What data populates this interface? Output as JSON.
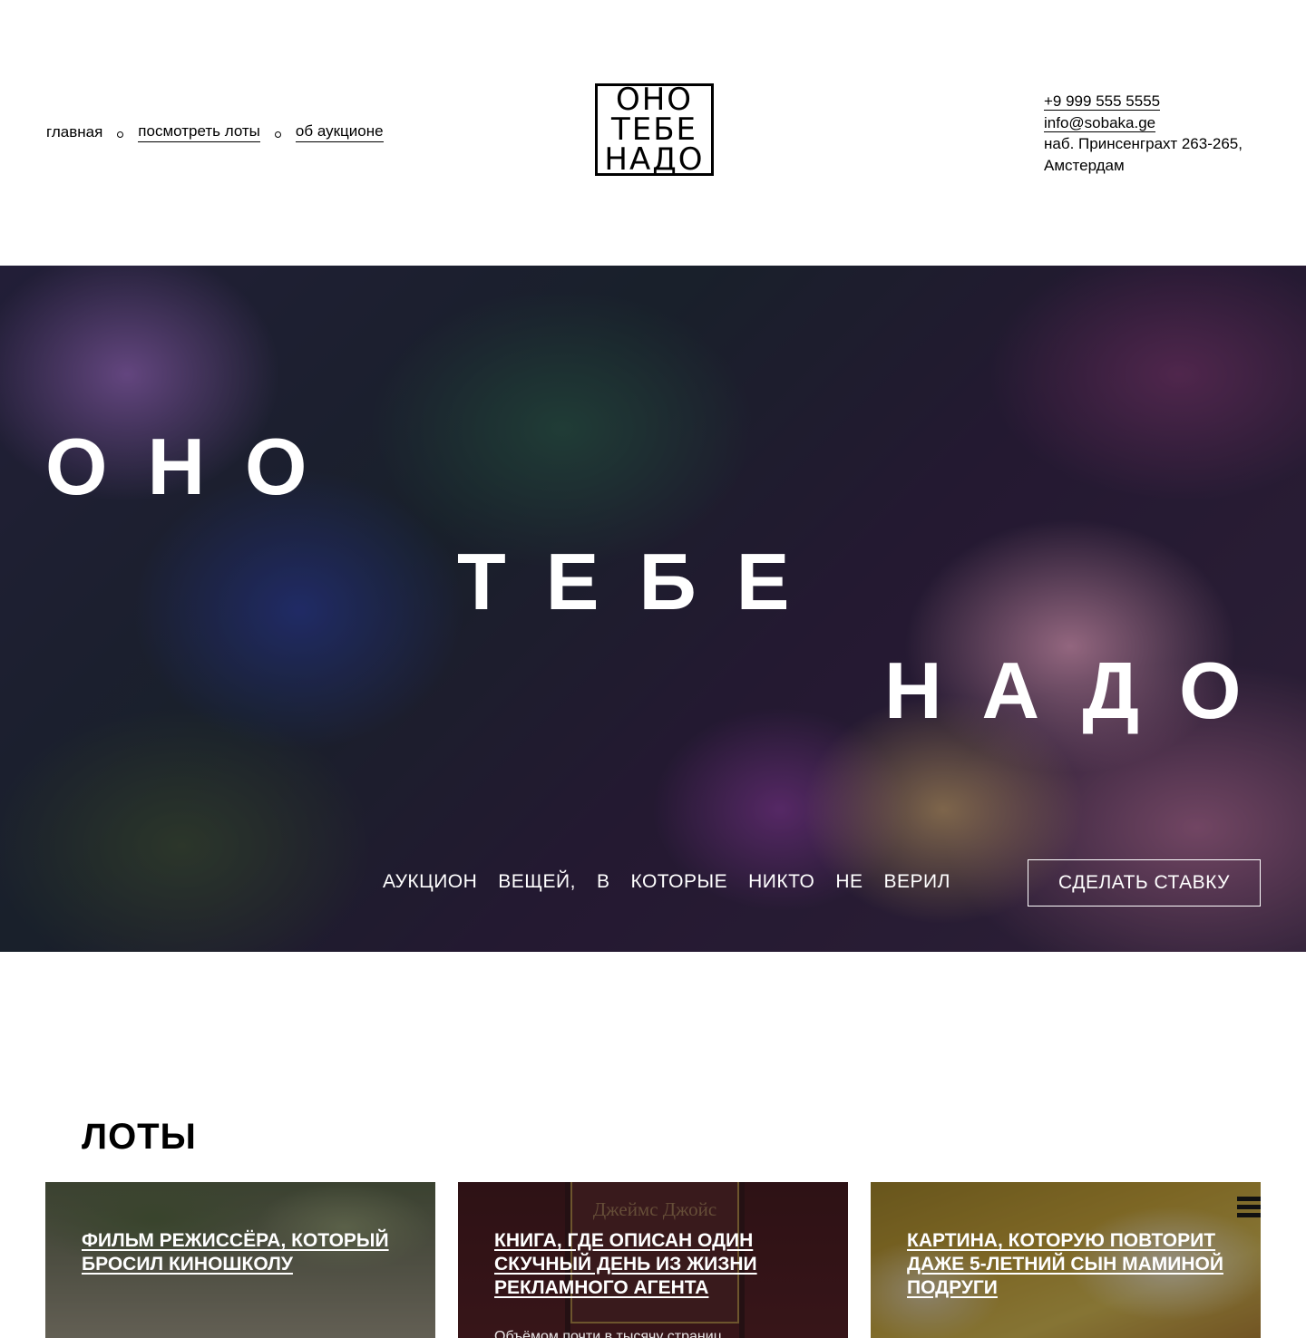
{
  "nav": {
    "items": [
      {
        "label": "главная"
      },
      {
        "label": "посмотреть лоты"
      },
      {
        "label": "об аукционе"
      }
    ]
  },
  "logo": {
    "lines": [
      "ОНО",
      "ТЕБЕ",
      "НАДО"
    ]
  },
  "contacts": {
    "phone": "+9 999 555 5555",
    "email": "info@sobaka.ge",
    "address_line1": "наб. Принсенграхт 263-265,",
    "address_line2": "Амстердам"
  },
  "hero": {
    "words": [
      "ОНО",
      "ТЕБЕ",
      "НАДО"
    ],
    "tagline": [
      "АУКЦИОН",
      "ВЕЩЕЙ,",
      "В",
      "КОТОРЫЕ",
      "НИКТО",
      "НЕ",
      "ВЕРИЛ"
    ],
    "cta_label": "СДЕЛАТЬ СТАВКУ"
  },
  "lots": {
    "heading": "ЛОТЫ",
    "cards": [
      {
        "title": "ФИЛЬМ РЕЖИССЁРА, КОТОРЫЙ БРОСИЛ КИНОШКОЛУ",
        "description": ""
      },
      {
        "title": "КНИГА, ГДЕ ОПИСАН ОДИН СКУЧНЫЙ ДЕНЬ ИЗ ЖИЗНИ РЕКЛАМНОГО АГЕНТА",
        "description": "Объёмом почти в тысячу страниц",
        "image_text": "Джеймс Джойс"
      },
      {
        "title": "КАРТИНА, КОТОРУЮ ПОВТОРИТ ДАЖЕ 5-ЛЕТНИЙ СЫН МАМИНОЙ ПОДРУГИ",
        "description": ""
      }
    ]
  },
  "icons": {
    "menu": "hamburger-menu-icon"
  }
}
